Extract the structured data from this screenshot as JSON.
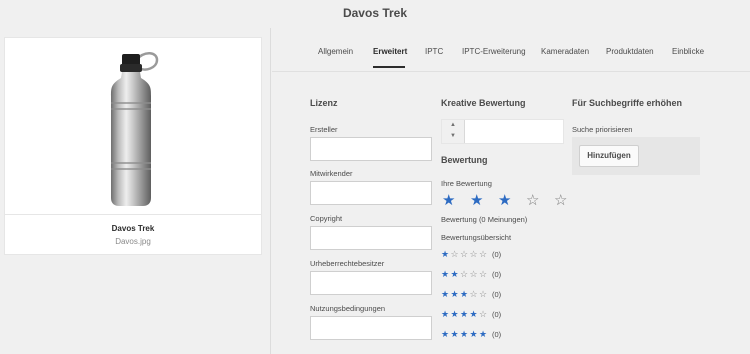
{
  "header": {
    "title": "Davos Trek"
  },
  "asset": {
    "name": "Davos Trek",
    "filename": "Davos.jpg"
  },
  "tabs": [
    {
      "label": "Allgemein",
      "active": false
    },
    {
      "label": "Erweitert",
      "active": true
    },
    {
      "label": "IPTC",
      "active": false
    },
    {
      "label": "IPTC-Erweiterung",
      "active": false
    },
    {
      "label": "Kameradaten",
      "active": false
    },
    {
      "label": "Produktdaten",
      "active": false
    },
    {
      "label": "Einblicke",
      "active": false
    }
  ],
  "license": {
    "title": "Lizenz",
    "fields": [
      {
        "label": "Ersteller",
        "value": ""
      },
      {
        "label": "Mitwirkender",
        "value": ""
      },
      {
        "label": "Copyright",
        "value": ""
      },
      {
        "label": "Urheberrechtebesitzer",
        "value": ""
      },
      {
        "label": "Nutzungsbedingungen",
        "value": ""
      }
    ]
  },
  "creative_rating": {
    "title": "Kreative Bewertung",
    "value": ""
  },
  "rating": {
    "title": "Bewertung",
    "your_rating_label": "Ihre Bewertung",
    "your_rating_value": 3,
    "max_stars": 5,
    "summary": "Bewertung (0 Meinungen)",
    "overview_label": "Bewertungsübersicht",
    "breakdown": [
      {
        "stars": 1,
        "count": "(0)"
      },
      {
        "stars": 2,
        "count": "(0)"
      },
      {
        "stars": 3,
        "count": "(0)"
      },
      {
        "stars": 4,
        "count": "(0)"
      },
      {
        "stars": 5,
        "count": "(0)"
      }
    ]
  },
  "search_boost": {
    "title": "Für Suchbegriffe erhöhen",
    "prioritize_label": "Suche priorisieren",
    "add_label": "Hinzufügen"
  },
  "colors": {
    "star_active": "#2d6bc2",
    "star_inactive": "#7a7a7a"
  },
  "icons": {
    "stepper_up": "chevron-up-icon",
    "stepper_down": "chevron-down-icon",
    "star": "star-icon"
  }
}
